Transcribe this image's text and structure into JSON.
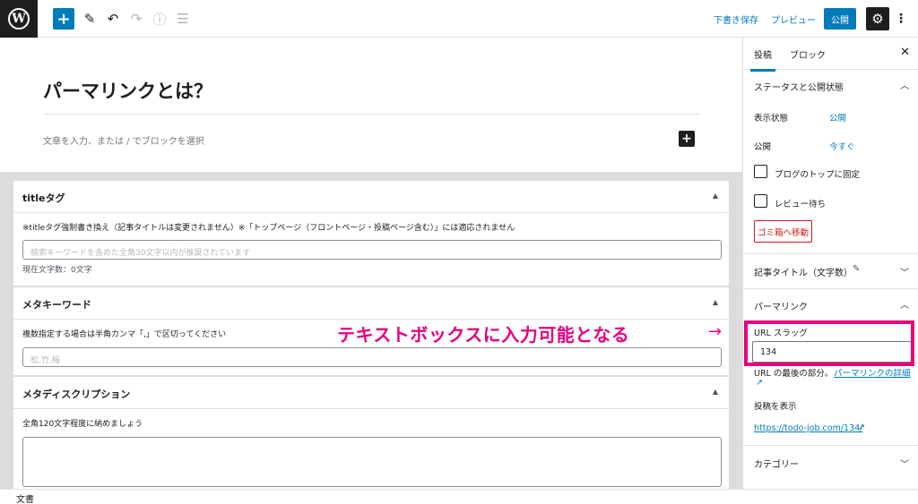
{
  "toolbar": {
    "add_icon": "plus-icon",
    "save_draft": "下書き保存",
    "preview": "プレビュー",
    "publish": "公開"
  },
  "editor": {
    "title": "パーマリンクとは？",
    "block_placeholder": "文章を入力、または / でブロックを選択"
  },
  "metaboxes": {
    "title_tag": {
      "heading": "titleタグ",
      "note": "※titleタグ強制書き換え（記事タイトルは変更されません）※「トップページ（フロントページ・投稿ページ含む）」には適応されません",
      "placeholder": "検索キーワードを含めた全角30文字以内が推奨されています",
      "count": "現在文字数：0文字"
    },
    "meta_keywords": {
      "heading": "メタキーワード",
      "note": "複数指定する場合は半角カンマ「,」で区切ってください",
      "placeholder": "松,竹,梅"
    },
    "meta_description": {
      "heading": "メタディスクリプション",
      "note": "全角120文字程度に納めましょう"
    }
  },
  "sidebar": {
    "tabs": [
      "投稿",
      "ブロック"
    ],
    "status": {
      "heading": "ステータスと公開状態",
      "visibility_label": "表示状態",
      "visibility_value": "公開",
      "publish_label": "公開",
      "publish_value": "今すぐ",
      "sticky_label": "ブログのトップに固定",
      "pending_label": "レビュー待ち",
      "trash": "ゴミ箱へ移動"
    },
    "post_title_count": "記事タイトル（文字数）",
    "permalink": {
      "heading": "パーマリンク",
      "slug_label": "URL スラッグ",
      "slug_value": "134",
      "help_text": "URL の最後の部分。",
      "help_link": "パーマリンクの詳細",
      "view_post": "投稿を表示",
      "post_url": "https://todo-job.com/134/"
    },
    "categories": "カテゴリー"
  },
  "footer": {
    "breadcrumb": "文書"
  },
  "annotation": {
    "callout": "テキストボックスに入力可能となる",
    "arrow": "→",
    "color": "#e6007e"
  },
  "colors": {
    "accent": "#007cba",
    "destructive": "#cc1818",
    "dark": "#1e1e1e"
  }
}
